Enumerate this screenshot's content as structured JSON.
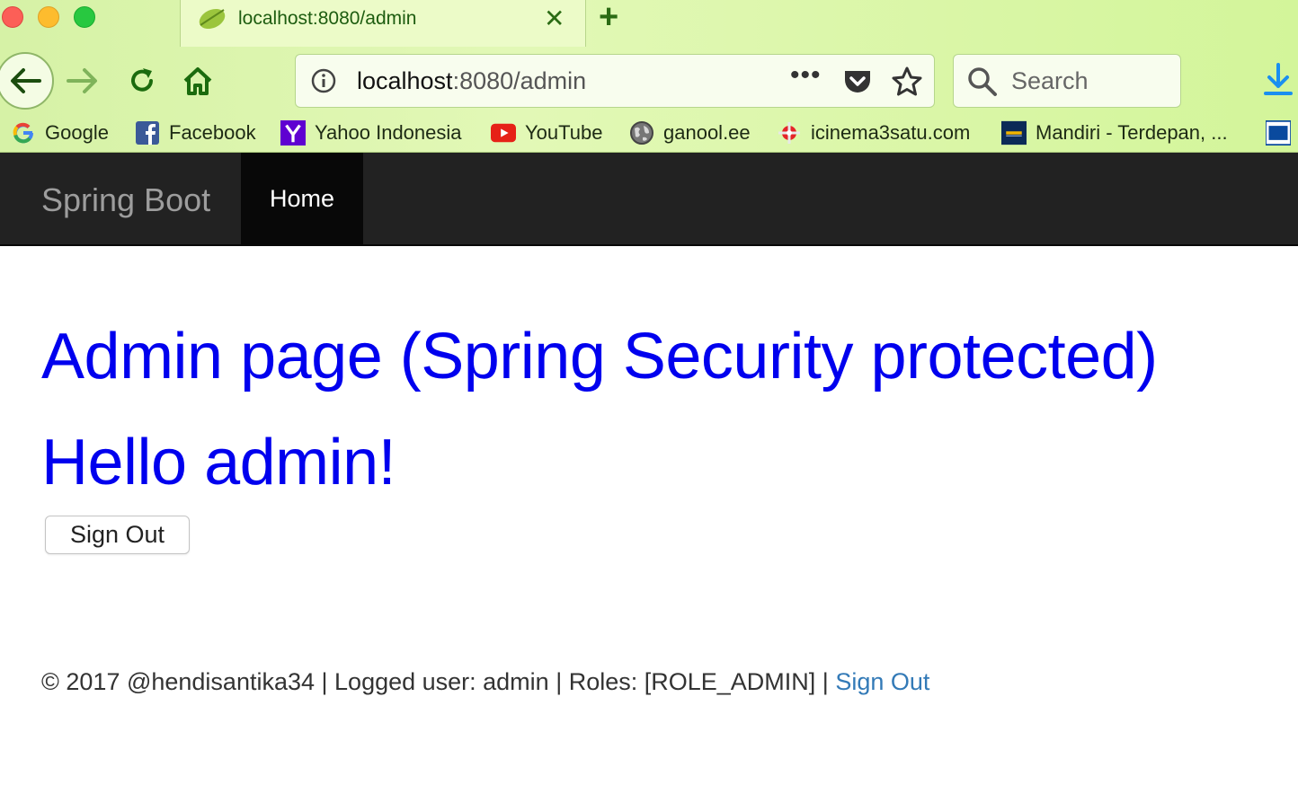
{
  "browser": {
    "tab": {
      "title": "localhost:8080/admin",
      "close_glyph": "✕"
    },
    "new_tab_glyph": "+",
    "url": {
      "host": "localhost",
      "rest": ":8080/admin",
      "more_glyph": "•••"
    },
    "search": {
      "placeholder": "Search"
    },
    "bookmarks": [
      {
        "label": "Google",
        "icon": "google-icon"
      },
      {
        "label": "Facebook",
        "icon": "facebook-icon"
      },
      {
        "label": "Yahoo Indonesia",
        "icon": "yahoo-icon"
      },
      {
        "label": "YouTube",
        "icon": "youtube-icon"
      },
      {
        "label": "ganool.ee",
        "icon": "globe-icon"
      },
      {
        "label": "icinema3satu.com",
        "icon": "icinema-icon"
      },
      {
        "label": "Mandiri - Terdepan, ...",
        "icon": "mandiri-icon"
      }
    ],
    "colors": {
      "accent": "#2b6b14",
      "chrome_bg": "#dcf5ad"
    }
  },
  "site": {
    "brand": "Spring Boot",
    "nav": {
      "home": "Home"
    },
    "heading": "Admin page (Spring Security protected)",
    "greeting": "Hello admin!",
    "signout_button": "Sign Out",
    "footer": {
      "text": "© 2017 @hendisantika34 | Logged user: admin | Roles: [ROLE_ADMIN] | ",
      "link": "Sign Out"
    },
    "colors": {
      "heading": "#0000ee",
      "navbar": "#222222",
      "link": "#337ab7"
    }
  }
}
